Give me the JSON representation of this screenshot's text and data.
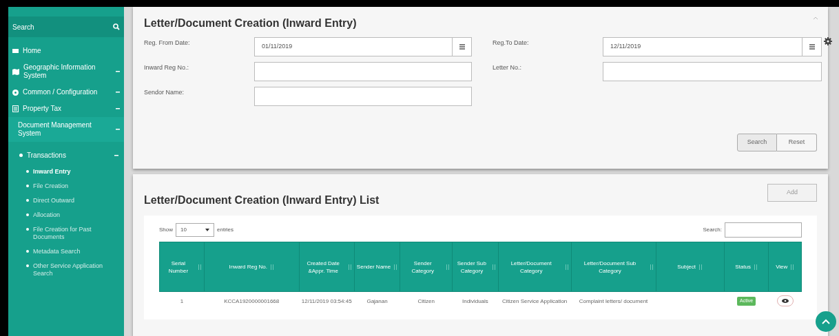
{
  "sidebar": {
    "search_label": "Search",
    "items": [
      {
        "label": "Home",
        "expandable": false,
        "expanded": false
      },
      {
        "label": "Geographic Information System",
        "expandable": true,
        "expanded": false
      },
      {
        "label": "Common / Configuration",
        "expandable": true,
        "expanded": false
      },
      {
        "label": "Property Tax",
        "expandable": true,
        "expanded": false
      },
      {
        "label": "Document Management System",
        "expandable": true,
        "expanded": true,
        "children": [
          {
            "label": "Transactions",
            "expandable": true,
            "expanded": true,
            "children": [
              {
                "label": "Inward Entry",
                "selected": true
              },
              {
                "label": "File Creation",
                "selected": false
              },
              {
                "label": "Direct Outward",
                "selected": false
              },
              {
                "label": "Allocation",
                "selected": false
              },
              {
                "label": "File Creation for Past Documents",
                "selected": false
              },
              {
                "label": "Metadata Search",
                "selected": false
              },
              {
                "label": "Other Service Application Search",
                "selected": false
              }
            ]
          }
        ]
      }
    ]
  },
  "filter_panel": {
    "title": "Letter/Document Creation (Inward Entry)",
    "fields": [
      {
        "label": "Reg. From Date:",
        "value": "01/11/2019",
        "kind": "date"
      },
      {
        "label": "Reg.To Date:",
        "value": "12/11/2019",
        "kind": "date"
      },
      {
        "label": "Inward Reg No.:",
        "kind": "text"
      },
      {
        "label": "Letter No.:",
        "kind": "text"
      },
      {
        "label": "Sendor Name:",
        "kind": "text"
      }
    ],
    "buttons": [
      "Search",
      "Reset"
    ]
  },
  "list_panel": {
    "title": "Letter/Document Creation (Inward Entry) List",
    "add_button": "Add",
    "show_label": "Show",
    "page_size": "10",
    "entries_label": "entries",
    "search_label": "Search:",
    "table": {
      "columns": [
        "Serial Number",
        "Inward Reg No.",
        "Created Date &Appr. Time",
        "Sender Name",
        "Sender Category",
        "Sender Sub Category",
        "Letter/Document Category",
        "Letter/Document Sub Category",
        "Subject",
        "Status",
        "View"
      ],
      "rows": [
        {
          "cells": [
            "1",
            "KCCA1920000001668",
            "12/11/2019 03:54:45",
            "Gajanan",
            "Citizen",
            "Individuals",
            "Citizen Service Application",
            "Complaint letters/ document",
            ""
          ],
          "status": "Active"
        }
      ]
    }
  }
}
